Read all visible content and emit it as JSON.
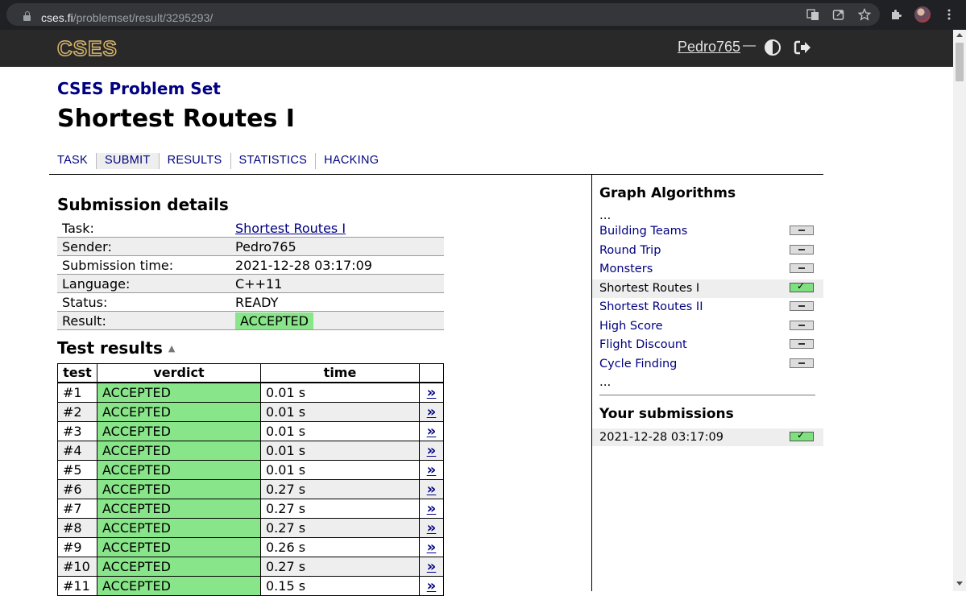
{
  "browser": {
    "url_host": "cses.fi",
    "url_path": "/problemset/result/3295293/"
  },
  "header": {
    "logo": "CSES",
    "username": "Pedro765",
    "separator": "—"
  },
  "page": {
    "section": "CSES Problem Set",
    "title": "Shortest Routes I",
    "nav": [
      "TASK",
      "SUBMIT",
      "RESULTS",
      "STATISTICS",
      "HACKING"
    ],
    "active_nav": "SUBMIT"
  },
  "submission": {
    "heading": "Submission details",
    "rows": [
      {
        "key": "Task:",
        "value": "Shortest Routes I"
      },
      {
        "key": "Sender:",
        "value": "Pedro765"
      },
      {
        "key": "Submission time:",
        "value": "2021-12-28 03:17:09"
      },
      {
        "key": "Language:",
        "value": "C++11"
      },
      {
        "key": "Status:",
        "value": "READY"
      },
      {
        "key": "Result:",
        "value": "ACCEPTED"
      }
    ]
  },
  "tests": {
    "heading": "Test results",
    "sort_indicator": "▲",
    "columns": [
      "test",
      "verdict",
      "time",
      ""
    ],
    "rows": [
      {
        "test": "#1",
        "verdict": "ACCEPTED",
        "time": "0.01 s",
        "link": "»"
      },
      {
        "test": "#2",
        "verdict": "ACCEPTED",
        "time": "0.01 s",
        "link": "»"
      },
      {
        "test": "#3",
        "verdict": "ACCEPTED",
        "time": "0.01 s",
        "link": "»"
      },
      {
        "test": "#4",
        "verdict": "ACCEPTED",
        "time": "0.01 s",
        "link": "»"
      },
      {
        "test": "#5",
        "verdict": "ACCEPTED",
        "time": "0.01 s",
        "link": "»"
      },
      {
        "test": "#6",
        "verdict": "ACCEPTED",
        "time": "0.27 s",
        "link": "»"
      },
      {
        "test": "#7",
        "verdict": "ACCEPTED",
        "time": "0.27 s",
        "link": "»"
      },
      {
        "test": "#8",
        "verdict": "ACCEPTED",
        "time": "0.27 s",
        "link": "»"
      },
      {
        "test": "#9",
        "verdict": "ACCEPTED",
        "time": "0.26 s",
        "link": "»"
      },
      {
        "test": "#10",
        "verdict": "ACCEPTED",
        "time": "0.27 s",
        "link": "»"
      },
      {
        "test": "#11",
        "verdict": "ACCEPTED",
        "time": "0.15 s",
        "link": "»"
      }
    ]
  },
  "sidebar": {
    "category": "Graph Algorithms",
    "ellipsis": "...",
    "problems": [
      {
        "name": "Building Teams",
        "status": "none"
      },
      {
        "name": "Round Trip",
        "status": "none"
      },
      {
        "name": "Monsters",
        "status": "none"
      },
      {
        "name": "Shortest Routes I",
        "status": "accepted",
        "current": true
      },
      {
        "name": "Shortest Routes II",
        "status": "none"
      },
      {
        "name": "High Score",
        "status": "none"
      },
      {
        "name": "Flight Discount",
        "status": "none"
      },
      {
        "name": "Cycle Finding",
        "status": "none"
      }
    ],
    "submissions_heading": "Your submissions",
    "submissions": [
      {
        "time": "2021-12-28 03:17:09",
        "status": "accepted"
      }
    ]
  },
  "colors": {
    "accepted": "#89e589",
    "link": "#000080",
    "header_bg": "#292929"
  }
}
